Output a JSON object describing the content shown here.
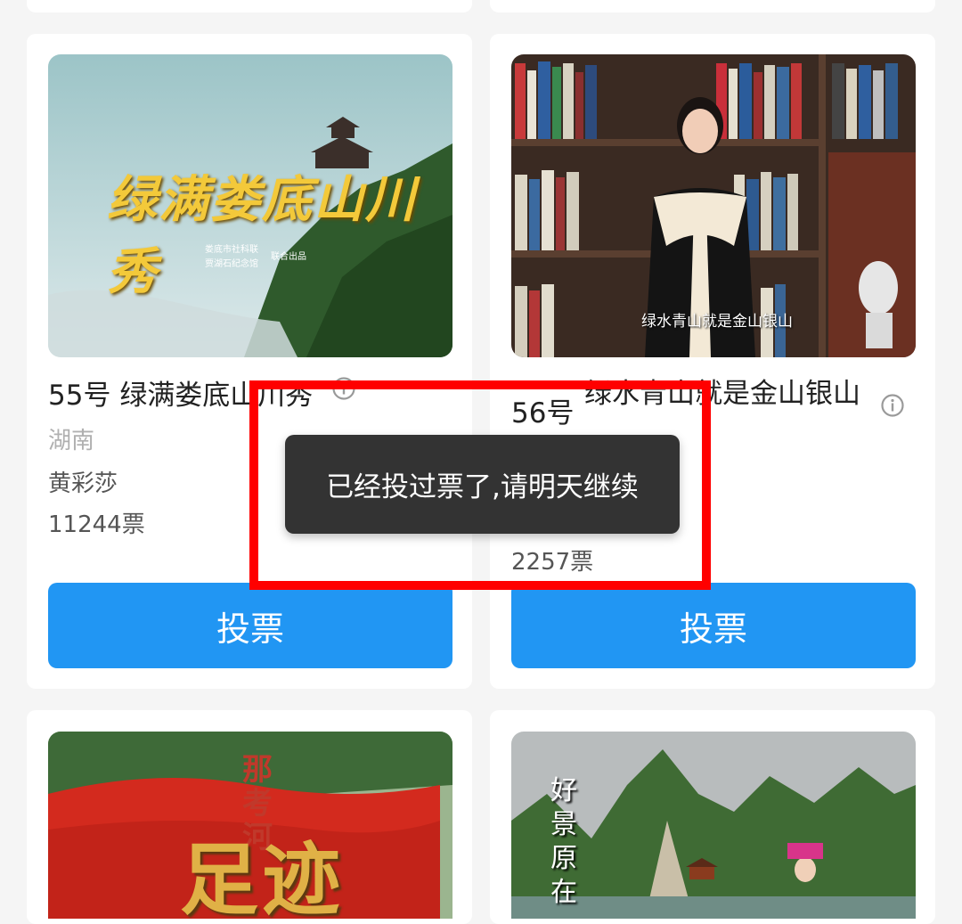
{
  "cards": [
    {
      "number": "55号",
      "title": "绿满娄底山川秀",
      "region": "湖南",
      "author": "黄彩莎",
      "votes": "11244票",
      "vote_label": "投票",
      "thumb_title": "绿满娄底山川秀",
      "thumb_credit_1": "娄底市社科联",
      "thumb_credit_2": "贾湖石纪念馆",
      "thumb_credit_3": "联合出品"
    },
    {
      "number": "56号",
      "title": "绿水青山就是金山银山",
      "votes": "2257票",
      "vote_label": "投票",
      "thumb_caption": "绿水青山就是金山银山"
    },
    {
      "thumb_title": "足迹",
      "thumb_sub": "那考河"
    },
    {
      "thumb_title": "好景原在"
    }
  ],
  "toast": {
    "message": "已经投过票了,请明天继续"
  },
  "colors": {
    "vote_button": "#2196f3",
    "highlight_border": "#ff0000",
    "toast_bg": "#333333"
  },
  "icons": {
    "info": "info-icon"
  }
}
